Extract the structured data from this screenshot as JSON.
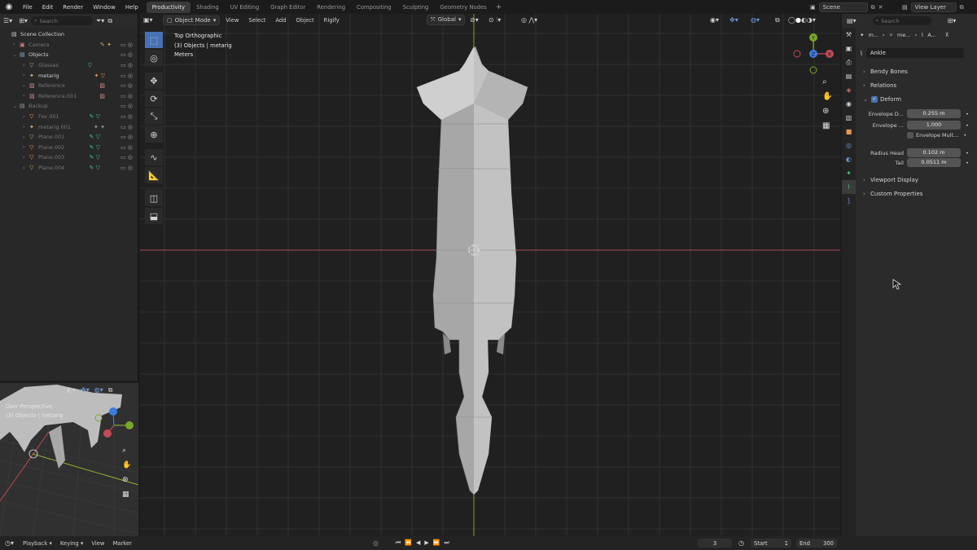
{
  "menu": [
    "File",
    "Edit",
    "Render",
    "Window",
    "Help"
  ],
  "workspace_tabs": [
    "Productivity",
    "Shading",
    "UV Editing",
    "Graph Editor",
    "Rendering",
    "Compositing",
    "Sculpting",
    "Geometry Nodes"
  ],
  "active_workspace": "Productivity",
  "scene": "Scene",
  "view_layer": "View Layer",
  "outliner": {
    "search_placeholder": "Search",
    "scene_collection": "Scene Collection",
    "rows": [
      {
        "name": "Camera",
        "dim": true
      },
      {
        "name": "Objects",
        "dim": false
      },
      {
        "name": "Glasses",
        "dim": true
      },
      {
        "name": "metarig",
        "dim": false
      },
      {
        "name": "Reference",
        "dim": true
      },
      {
        "name": "Reference.001",
        "dim": true
      },
      {
        "name": "Backup",
        "dim": true
      },
      {
        "name": "Fox.001",
        "dim": true
      },
      {
        "name": "metarig.001",
        "dim": true
      },
      {
        "name": "Plane.001",
        "dim": true
      },
      {
        "name": "Plane.002",
        "dim": true
      },
      {
        "name": "Plane.003",
        "dim": true
      },
      {
        "name": "Plane.004",
        "dim": true
      }
    ]
  },
  "viewport": {
    "mode": "Object Mode",
    "menus": [
      "View",
      "Select",
      "Add",
      "Object",
      "Rigify"
    ],
    "orientation": "Global",
    "overlay_title": "Top Orthographic",
    "overlay_context": "(3) Objects | metarig",
    "overlay_units": "Meters"
  },
  "mini_viewport": {
    "overlay_title": "User Perspective",
    "overlay_context": "(3) Objects | metarig"
  },
  "properties": {
    "search_placeholder": "Search",
    "breadcrumb": [
      "m...",
      "me...",
      "A..."
    ],
    "bone_name": "Ankle",
    "panels": {
      "bendy_bones": "Bendy Bones",
      "relations": "Relations",
      "deform": "Deform",
      "viewport_display": "Viewport Display",
      "custom_properties": "Custom Properties"
    },
    "envelope_distance_label": "Envelope D...",
    "envelope_distance": "0.255 m",
    "envelope_weight_label": "Envelope ...",
    "envelope_weight": "1.000",
    "envelope_multiply_label": "Envelope Mult...",
    "radius_head_label": "Radius Head",
    "radius_head": "0.102 m",
    "radius_tail_label": "Tail",
    "radius_tail": "0.0511 m"
  },
  "timeline": {
    "menus": [
      "Playback",
      "Keying",
      "View",
      "Marker"
    ],
    "current_frame": "3",
    "start_label": "Start",
    "start": "1",
    "end_label": "End",
    "end": "300"
  },
  "gizmo_axes": [
    "Y",
    "X",
    "Z"
  ]
}
